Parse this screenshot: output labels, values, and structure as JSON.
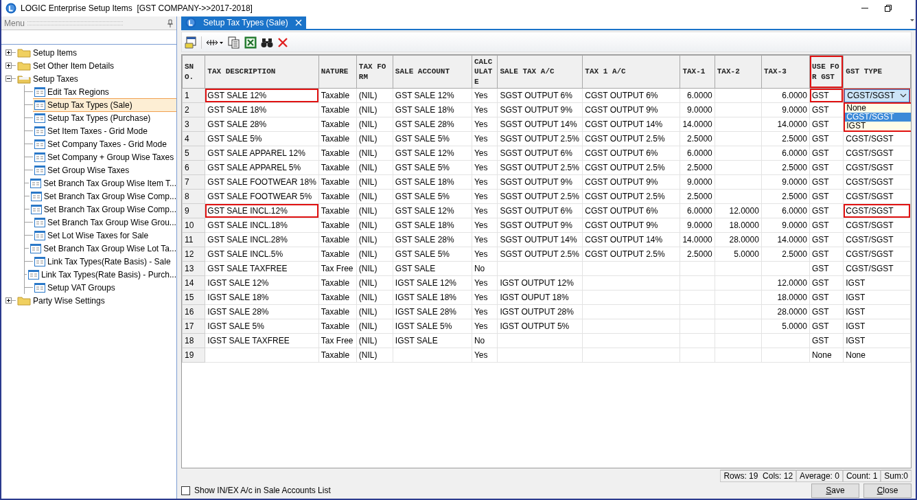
{
  "window": {
    "title": "LOGIC Enterprise Setup Items  [GST COMPANY->>2017-2018]"
  },
  "sidebar": {
    "title": "Menu",
    "items": [
      {
        "label": "Setup Items",
        "kind": "folder",
        "expanded": false,
        "selected": false
      },
      {
        "label": "Set Other Item Details",
        "kind": "folder",
        "expanded": false,
        "selected": false
      },
      {
        "label": "Setup Taxes",
        "kind": "folder",
        "expanded": true,
        "selected": false,
        "children": [
          {
            "label": "Edit Tax Regions",
            "kind": "form",
            "selected": false
          },
          {
            "label": "Setup Tax Types (Sale)",
            "kind": "form",
            "selected": true
          },
          {
            "label": "Setup Tax Types (Purchase)",
            "kind": "form",
            "selected": false
          },
          {
            "label": "Set Item Taxes - Grid Mode",
            "kind": "form",
            "selected": false
          },
          {
            "label": "Set Company Taxes - Grid Mode",
            "kind": "form",
            "selected": false
          },
          {
            "label": "Set Company + Group Wise Taxes",
            "kind": "form",
            "selected": false
          },
          {
            "label": "Set Group Wise Taxes",
            "kind": "form",
            "selected": false
          },
          {
            "label": "Set Branch Tax Group Wise Item T...",
            "kind": "form",
            "selected": false
          },
          {
            "label": "Set Branch Tax Group Wise Comp...",
            "kind": "form",
            "selected": false
          },
          {
            "label": "Set Branch Tax Group Wise Comp...",
            "kind": "form",
            "selected": false
          },
          {
            "label": "Set Branch Tax Group Wise Grou...",
            "kind": "form",
            "selected": false
          },
          {
            "label": "Set Lot Wise Taxes for Sale",
            "kind": "form",
            "selected": false
          },
          {
            "label": "Set Branch Tax Group Wise Lot Ta...",
            "kind": "form",
            "selected": false
          },
          {
            "label": "Link Tax Types(Rate Basis) - Sale",
            "kind": "form",
            "selected": false
          },
          {
            "label": "Link Tax Types(Rate Basis) - Purch...",
            "kind": "form",
            "selected": false
          },
          {
            "label": "Setup VAT Groups",
            "kind": "form",
            "selected": false
          }
        ]
      },
      {
        "label": "Party Wise Settings",
        "kind": "folder",
        "expanded": false,
        "selected": false
      }
    ]
  },
  "tabs": [
    {
      "label": "Setup Tax Types (Sale)",
      "selected": true
    }
  ],
  "table": {
    "columns": [
      {
        "label": "SNO.",
        "kind": "index"
      },
      {
        "label": "TAX DESCRIPTION",
        "kind": "text"
      },
      {
        "label": "NATURE",
        "kind": "text"
      },
      {
        "label": "TAX FORM",
        "kind": "text"
      },
      {
        "label": "SALE ACCOUNT",
        "kind": "text"
      },
      {
        "label": "CALCULATE",
        "kind": "text"
      },
      {
        "label": "SALE TAX A/C",
        "kind": "text"
      },
      {
        "label": "TAX 1 A/C",
        "kind": "text"
      },
      {
        "label": "TAX-1",
        "kind": "number"
      },
      {
        "label": "TAX-2",
        "kind": "number"
      },
      {
        "label": "TAX-3",
        "kind": "number"
      },
      {
        "label": "USE FOR GST",
        "kind": "text",
        "outlined": true
      },
      {
        "label": "GST TYPE",
        "kind": "text"
      }
    ],
    "rows": [
      {
        "cells": [
          "1",
          {
            "text": "GST SALE 12%",
            "outlined": true
          },
          "Taxable",
          "(NIL)",
          "GST SALE 12%",
          "Yes",
          "SGST OUTPUT 6%",
          "CGST OUTPUT 6%",
          "6.0000",
          null,
          "6.0000",
          {
            "text": "GST",
            "outlined": true
          },
          {
            "kind": "dropdown",
            "text": "CGST/SGST",
            "open": true,
            "outlined": true,
            "options": [
              {
                "label": "None",
                "selected": false
              },
              {
                "label": "CGST/SGST",
                "selected": true
              },
              {
                "label": "IGST",
                "selected": false
              }
            ]
          }
        ]
      },
      {
        "cells": [
          "2",
          "GST SALE 18%",
          "Taxable",
          "(NIL)",
          "GST SALE 18%",
          "Yes",
          "SGST OUTPUT 9%",
          "CGST OUTPUT 9%",
          "9.0000",
          null,
          "9.0000",
          "GST",
          null
        ]
      },
      {
        "cells": [
          "3",
          "GST SALE 28%",
          "Taxable",
          "(NIL)",
          "GST SALE 28%",
          "Yes",
          "SGST OUTPUT 14%",
          "CGST OUTPUT 14%",
          "14.0000",
          null,
          "14.0000",
          "GST",
          null
        ]
      },
      {
        "cells": [
          "4",
          "GST SALE 5%",
          "Taxable",
          "(NIL)",
          "GST SALE 5%",
          "Yes",
          "SGST OUTPUT 2.5%",
          "CGST OUTPUT 2.5%",
          "2.5000",
          null,
          "2.5000",
          "GST",
          "CGST/SGST"
        ]
      },
      {
        "cells": [
          "5",
          "GST SALE APPAREL 12%",
          "Taxable",
          "(NIL)",
          "GST SALE 12%",
          "Yes",
          "SGST OUTPUT 6%",
          "CGST OUTPUT 6%",
          "6.0000",
          null,
          "6.0000",
          "GST",
          "CGST/SGST"
        ]
      },
      {
        "cells": [
          "6",
          "GST SALE APPAREL 5%",
          "Taxable",
          "(NIL)",
          "GST SALE 5%",
          "Yes",
          "SGST OUTPUT 2.5%",
          "CGST OUTPUT 2.5%",
          "2.5000",
          null,
          "2.5000",
          "GST",
          "CGST/SGST"
        ]
      },
      {
        "cells": [
          "7",
          "GST SALE FOOTWEAR 18%",
          "Taxable",
          "(NIL)",
          "GST SALE 18%",
          "Yes",
          "SGST OUTPUT 9%",
          "CGST OUTPUT 9%",
          "9.0000",
          null,
          "9.0000",
          "GST",
          "CGST/SGST"
        ]
      },
      {
        "cells": [
          "8",
          "GST SALE FOOTWEAR 5%",
          "Taxable",
          "(NIL)",
          "GST SALE 5%",
          "Yes",
          "SGST OUTPUT 2.5%",
          "CGST OUTPUT 2.5%",
          "2.5000",
          null,
          "2.5000",
          "GST",
          "CGST/SGST"
        ]
      },
      {
        "cells": [
          "9",
          {
            "text": "GST SALE INCL.12%",
            "outlined": true
          },
          "Taxable",
          "(NIL)",
          "GST SALE 12%",
          "Yes",
          "SGST OUTPUT 6%",
          "CGST OUTPUT 6%",
          "6.0000",
          "12.0000",
          "6.0000",
          "GST",
          {
            "text": "CGST/SGST",
            "outlined": true
          }
        ]
      },
      {
        "cells": [
          "10",
          "GST SALE INCL.18%",
          "Taxable",
          "(NIL)",
          "GST SALE 18%",
          "Yes",
          "SGST OUTPUT 9%",
          "CGST OUTPUT 9%",
          "9.0000",
          "18.0000",
          "9.0000",
          "GST",
          "CGST/SGST"
        ]
      },
      {
        "cells": [
          "11",
          "GST SALE INCL.28%",
          "Taxable",
          "(NIL)",
          "GST SALE 28%",
          "Yes",
          "SGST OUTPUT 14%",
          "CGST OUTPUT 14%",
          "14.0000",
          "28.0000",
          "14.0000",
          "GST",
          "CGST/SGST"
        ]
      },
      {
        "cells": [
          "12",
          "GST SALE INCL.5%",
          "Taxable",
          "(NIL)",
          "GST SALE 5%",
          "Yes",
          "SGST OUTPUT 2.5%",
          "CGST OUTPUT 2.5%",
          "2.5000",
          "5.0000",
          "2.5000",
          "GST",
          "CGST/SGST"
        ]
      },
      {
        "cells": [
          "13",
          "GST SALE TAXFREE",
          "Tax Free",
          "(NIL)",
          "GST SALE",
          "No",
          null,
          null,
          null,
          null,
          null,
          "GST",
          "CGST/SGST"
        ]
      },
      {
        "cells": [
          "14",
          "IGST SALE 12%",
          "Taxable",
          "(NIL)",
          "IGST SALE 12%",
          "Yes",
          "IGST OUTPUT 12%",
          null,
          null,
          null,
          "12.0000",
          "GST",
          "IGST"
        ]
      },
      {
        "cells": [
          "15",
          "IGST SALE 18%",
          "Taxable",
          "(NIL)",
          "IGST SALE 18%",
          "Yes",
          "IGST OUPUT 18%",
          null,
          null,
          null,
          "18.0000",
          "GST",
          "IGST"
        ]
      },
      {
        "cells": [
          "16",
          "IGST SALE 28%",
          "Taxable",
          "(NIL)",
          "IGST SALE 28%",
          "Yes",
          "IGST OUTPUT 28%",
          null,
          null,
          null,
          "28.0000",
          "GST",
          "IGST"
        ]
      },
      {
        "cells": [
          "17",
          "IGST SALE 5%",
          "Taxable",
          "(NIL)",
          "IGST SALE 5%",
          "Yes",
          "IGST OUTPUT 5%",
          null,
          null,
          null,
          "5.0000",
          "GST",
          "IGST"
        ]
      },
      {
        "cells": [
          "18",
          "IGST SALE TAXFREE",
          "Tax Free",
          "(NIL)",
          "IGST SALE",
          "No",
          null,
          null,
          null,
          null,
          null,
          "GST",
          "IGST"
        ]
      },
      {
        "cells": [
          "19",
          null,
          "Taxable",
          "(NIL)",
          null,
          "Yes",
          null,
          null,
          null,
          null,
          null,
          "None",
          "None"
        ]
      }
    ]
  },
  "status_bar": [
    "Rows: 19  Cols: 12",
    "Average: 0",
    "Count: 1",
    "Sum:0"
  ],
  "footer": {
    "checkbox": {
      "label": "Show IN/EX A/c in Sale Accounts List",
      "checked": false
    },
    "buttons": [
      "Save",
      "Close"
    ]
  }
}
